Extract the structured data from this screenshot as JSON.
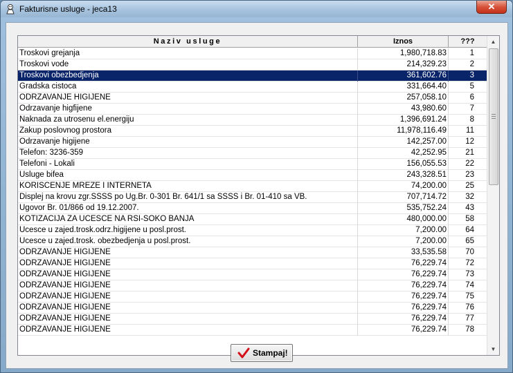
{
  "window": {
    "title": "Fakturisne usluge - jeca13",
    "close_glyph": "✕"
  },
  "table": {
    "columns": [
      "Naziv usluge",
      "Iznos",
      "???"
    ],
    "selected_index": 2,
    "rows": [
      {
        "name": "Troskovi grejanja",
        "amount": "1,980,718.83",
        "num": "1"
      },
      {
        "name": "Troskovi vode",
        "amount": "214,329.23",
        "num": "2"
      },
      {
        "name": "Troskovi obezbedjenja",
        "amount": "361,602.76",
        "num": "3"
      },
      {
        "name": "Gradska cistoca",
        "amount": "331,664.40",
        "num": "5"
      },
      {
        "name": "ODRZAVANJE HIGIJENE",
        "amount": "257,058.10",
        "num": "6"
      },
      {
        "name": "Odrzavanje higfijene",
        "amount": "43,980.60",
        "num": "7"
      },
      {
        "name": "Naknada za utrosenu el.energiju",
        "amount": "1,396,691.24",
        "num": "8"
      },
      {
        "name": "Zakup poslovnog prostora",
        "amount": "11,978,116.49",
        "num": "11"
      },
      {
        "name": "Odrzavanje higijene",
        "amount": "142,257.00",
        "num": "12"
      },
      {
        "name": "Telefon: 3236-359",
        "amount": "42,252.95",
        "num": "21"
      },
      {
        "name": "Telefoni - Lokali",
        "amount": "156,055.53",
        "num": "22"
      },
      {
        "name": "Usluge bifea",
        "amount": "243,328.51",
        "num": "23"
      },
      {
        "name": "KORISCENJE  MREZE I INTERNETA",
        "amount": "74,200.00",
        "num": "25"
      },
      {
        "name": "Displej na krovu zgr.SSSS po Ug.Br. 0-301 Br. 641/1 sa SSSS i Br. 01-410 sa VB.",
        "amount": "707,714.72",
        "num": "32"
      },
      {
        "name": "Ugovor Br. 01/866 od 19.12.2007.",
        "amount": "535,752.24",
        "num": "43"
      },
      {
        "name": "KOTIZACIJA ZA UCESCE NA RSI-SOKO BANJA",
        "amount": "480,000.00",
        "num": "58"
      },
      {
        "name": "Ucesce u zajed.trosk.odrz.higijene u posl.prost.",
        "amount": "7,200.00",
        "num": "64"
      },
      {
        "name": "Ucesce u zajed.trosk. obezbedjenja u posl.prost.",
        "amount": "7,200.00",
        "num": "65"
      },
      {
        "name": "ODRZAVANJE HIGIJENE",
        "amount": "33,535.58",
        "num": "70"
      },
      {
        "name": "ODRZAVANJE HIGIJENE",
        "amount": "76,229.74",
        "num": "72"
      },
      {
        "name": "ODRZAVANJE HIGIJENE",
        "amount": "76,229.74",
        "num": "73"
      },
      {
        "name": "ODRZAVANJE HIGIJENE",
        "amount": "76,229.74",
        "num": "74"
      },
      {
        "name": "ODRZAVANJE HIGIJENE",
        "amount": "76,229.74",
        "num": "75"
      },
      {
        "name": "ODRZAVANJE HIGIJENE",
        "amount": "76,229.74",
        "num": "76"
      },
      {
        "name": "ODRZAVANJE HIGIJENE",
        "amount": "76,229.74",
        "num": "77"
      },
      {
        "name": "ODRZAVANJE HIGIJENE",
        "amount": "76,229.74",
        "num": "78"
      }
    ]
  },
  "buttons": {
    "print_label": "Stampaj!"
  },
  "scrollbar": {
    "up_glyph": "▲",
    "down_glyph": "▼"
  }
}
